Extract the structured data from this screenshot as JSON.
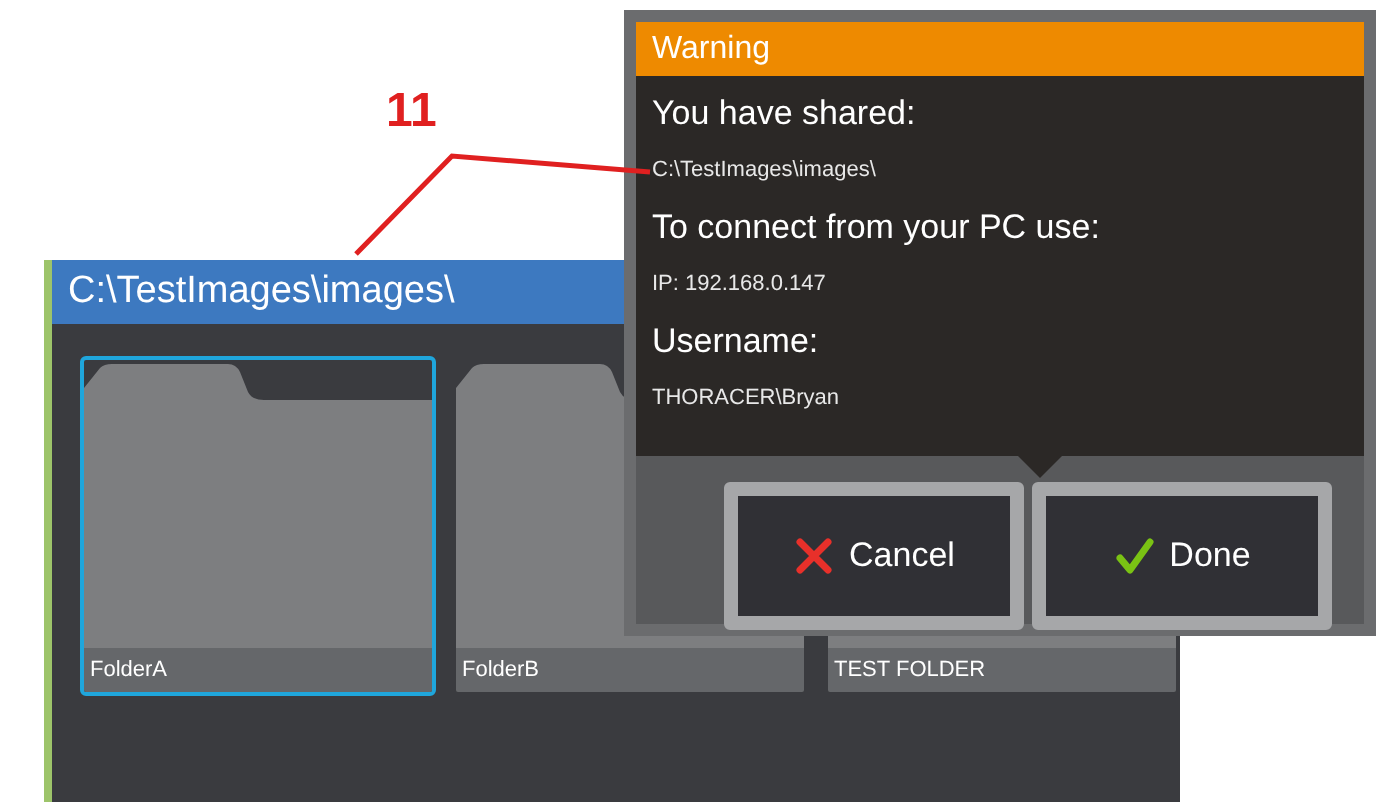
{
  "callout": {
    "label": "11"
  },
  "file_browser": {
    "path": "C:\\TestImages\\images\\",
    "folders": [
      {
        "name": "FolderA",
        "selected": true
      },
      {
        "name": "FolderB",
        "selected": false
      },
      {
        "name": "TEST FOLDER",
        "selected": false
      }
    ]
  },
  "dialog": {
    "title": "Warning",
    "lines": [
      {
        "kind": "heading",
        "text": "You have shared:"
      },
      {
        "kind": "value",
        "text": "C:\\TestImages\\images\\"
      },
      {
        "kind": "heading",
        "text": "To connect from your PC use:"
      },
      {
        "kind": "value",
        "text": "IP: 192.168.0.147"
      },
      {
        "kind": "heading",
        "text": "Username:"
      },
      {
        "kind": "value",
        "text": "THORACER\\Bryan"
      }
    ],
    "buttons": [
      {
        "kind": "cancel",
        "label": "Cancel"
      },
      {
        "kind": "done",
        "label": "Done"
      }
    ]
  }
}
